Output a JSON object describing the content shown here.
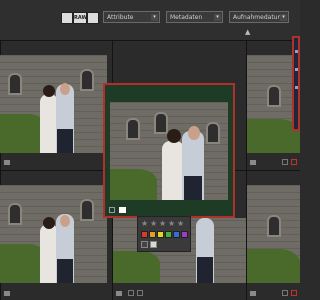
{
  "toolbar": {
    "icon1": "image-icon",
    "icon2_label": "RAW",
    "icon3": "grid-icon",
    "filters": [
      {
        "label": "Attribute"
      },
      {
        "label": "Metadaten"
      },
      {
        "label": "Aufnahmedatum"
      }
    ]
  },
  "colors": {
    "accent_red": "#b0302d",
    "panel_bg": "#2b2b2b",
    "loupe_bg": "#1e3b26"
  },
  "icons": {
    "flag": "flag-icon",
    "chevron": "chevron-up-icon",
    "star": "star-icon",
    "color_labels": [
      "red",
      "orange",
      "yellow",
      "green",
      "blue",
      "purple"
    ]
  }
}
